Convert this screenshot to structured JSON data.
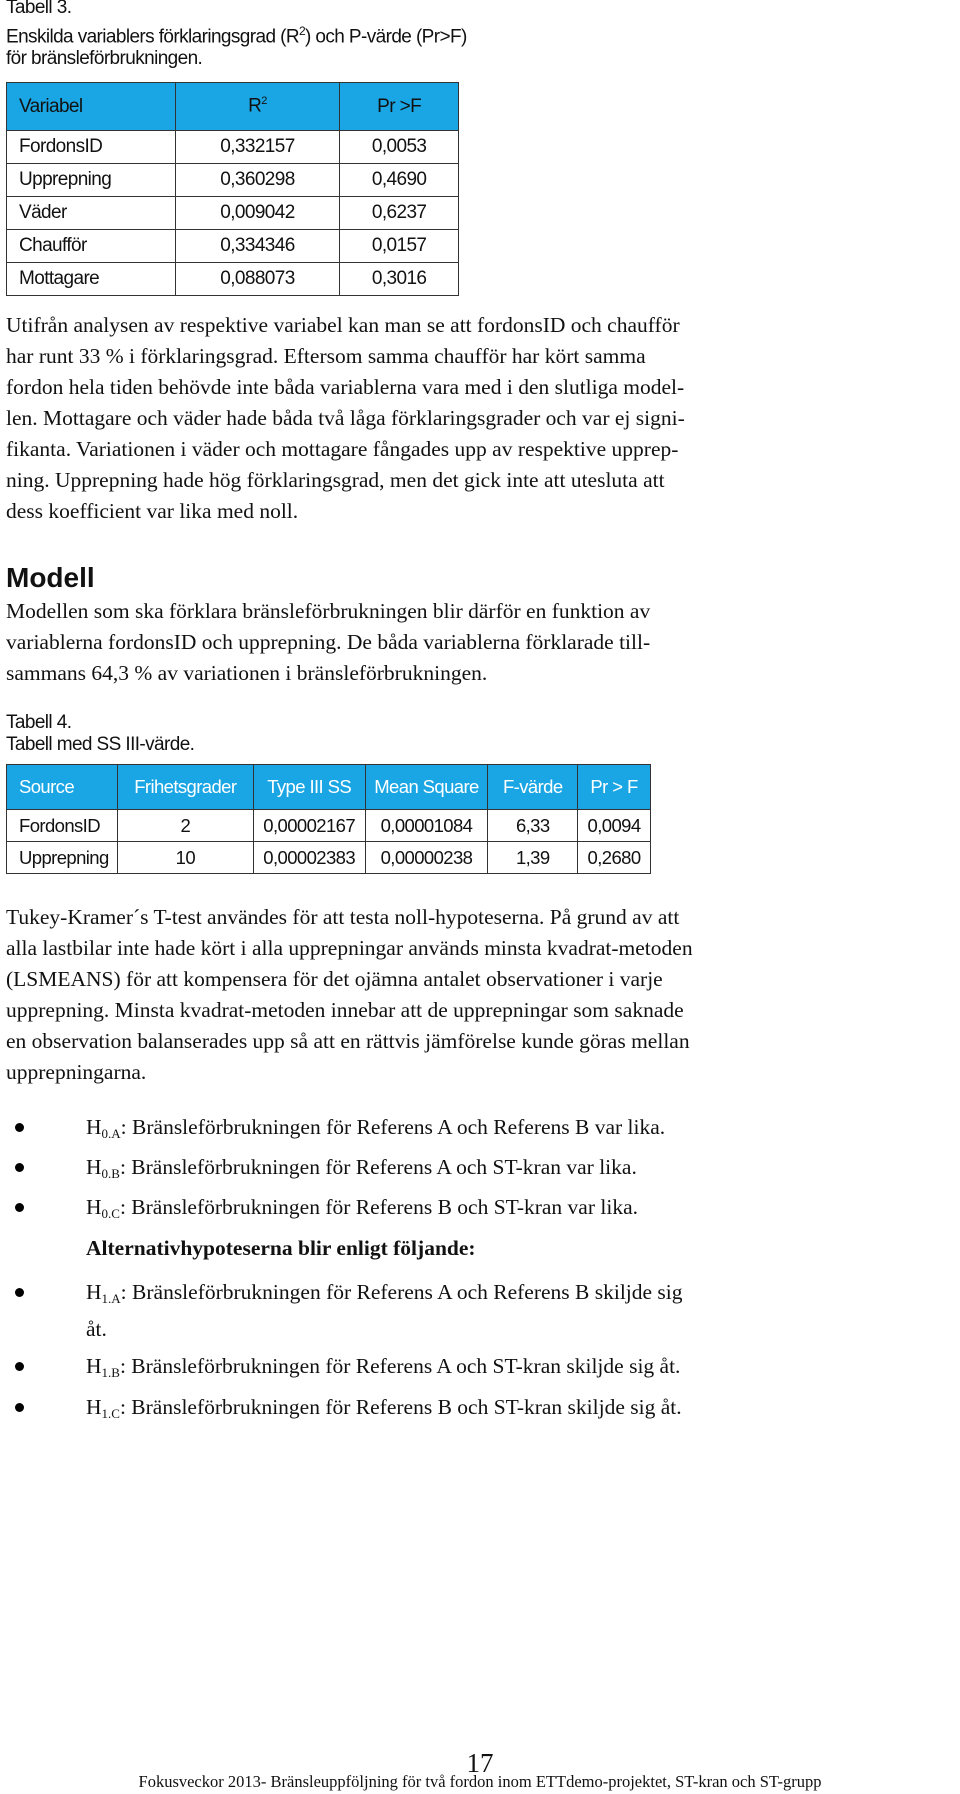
{
  "table3": {
    "label": "Tabell 3.",
    "caption_line1": "Enskilda variablers förklaringsgrad (R",
    "caption_sup": "2",
    "caption_line1_end": ") och P-värde (Pr>F)",
    "caption_line2": "för bränsleförbrukningen.",
    "headers": {
      "variable": "Variabel",
      "r2": "R",
      "r2_sup": "2",
      "pr": "Pr >F"
    },
    "header_color": "#1aa6e4",
    "rows": [
      [
        "FordonsID",
        "0,332157",
        "0,0053"
      ],
      [
        "Upprepning",
        "0,360298",
        "0,4690"
      ],
      [
        "Väder",
        "0,009042",
        "0,6237"
      ],
      [
        "Chaufför",
        "0,334346",
        "0,0157"
      ],
      [
        "Mottagare",
        "0,088073",
        "0,3016"
      ]
    ]
  },
  "paragraph1": [
    "Utifrån analysen av respektive variabel kan man se att fordonsID och chaufför",
    "har runt 33 % i förklaringsgrad. Eftersom samma chaufför har kört samma",
    "fordon hela tiden behövde inte båda variablerna vara med i den slutliga model-",
    "len. Mottagare och väder hade båda två låga förklaringsgrader och var ej signi-",
    "fikanta. Variationen i väder och mottagare fångades upp av respektive upprep-",
    "ning. Upprepning hade hög förklaringsgrad, men det gick inte att utesluta att",
    "dess koefficient var lika med noll."
  ],
  "section_heading": "Modell",
  "paragraph2": [
    "Modellen som ska förklara bränsleförbrukningen blir därför en funktion av",
    "variablerna fordonsID och upprepning. De båda variablerna förklarade till-",
    "sammans 64,3 % av variationen i bränsleförbrukningen."
  ],
  "table4": {
    "label": "Tabell 4.",
    "caption": "Tabell med SS III-värde.",
    "headers": [
      "Source",
      "Frihetsgrader",
      "Type III SS",
      "Mean Square",
      "F-värde",
      "Pr > F"
    ],
    "rows": [
      [
        "FordonsID",
        "2",
        "0,00002167",
        "0,00001084",
        "6,33",
        "0,0094"
      ],
      [
        "Upprepning",
        "10",
        "0,00002383",
        "0,00000238",
        "1,39",
        "0,2680"
      ]
    ]
  },
  "paragraph3": [
    "Tukey-Kramer´s T-test användes för att testa noll-hypoteserna. På grund av att",
    "alla lastbilar inte hade kört i alla upprepningar används minsta kvadrat-metoden",
    "(LSMEANS) för att kompensera för det ojämna antalet observationer i varje",
    "upprepning. Minsta kvadrat-metoden innebar att de upprepningar som saknade",
    "en observation balanserades upp så att en rättvis jämförelse kunde göras mellan",
    "upprepningarna."
  ],
  "null_hypotheses": [
    {
      "h": "H",
      "sub": "0.A",
      "text": ": Bränsleförbrukningen för Referens A och Referens B var lika."
    },
    {
      "h": "H",
      "sub": "0.B",
      "text": ": Bränsleförbrukningen för Referens A och ST-kran var lika."
    },
    {
      "h": "H",
      "sub": "0.C",
      "text": ": Bränsleförbrukningen för Referens B och ST-kran var lika."
    }
  ],
  "alt_heading": "Alternativhypoteserna blir enligt följande:",
  "alt_hypotheses": [
    {
      "h": "H",
      "sub": "1.A",
      "text": ": Bränsleförbrukningen för Referens A och Referens B skiljde sig",
      "cont": "åt."
    },
    {
      "h": "H",
      "sub": "1.B",
      "text": ": Bränsleförbrukningen för Referens A och ST-kran skiljde sig åt."
    },
    {
      "h": "H",
      "sub": "1.C",
      "text": ": Bränsleförbrukningen för Referens B och ST-kran skiljde sig åt."
    }
  ],
  "footer": {
    "page_number": "17",
    "text": "Fokusveckor 2013- Bränsleuppföljning för två fordon inom ETTdemo-projektet, ST-kran och ST-grupp"
  }
}
